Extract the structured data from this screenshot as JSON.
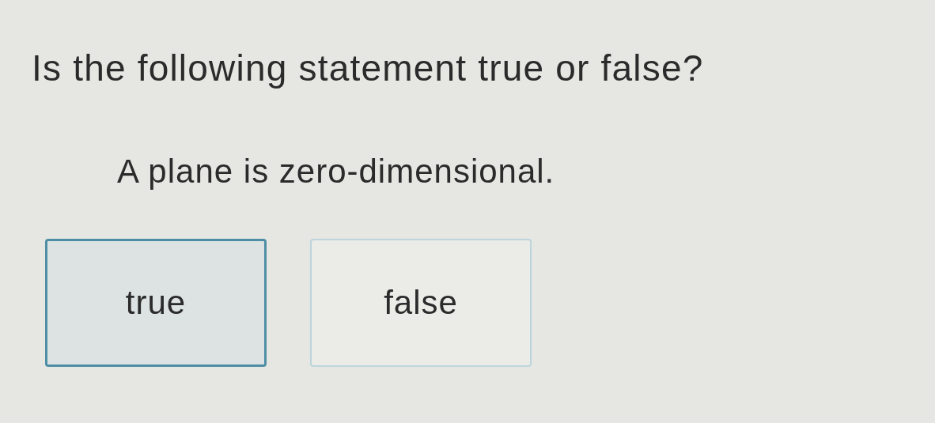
{
  "question": "Is the following statement true or false?",
  "statement": "A plane is zero-dimensional.",
  "options": [
    {
      "label": "true",
      "selected": true
    },
    {
      "label": "false",
      "selected": false
    }
  ]
}
